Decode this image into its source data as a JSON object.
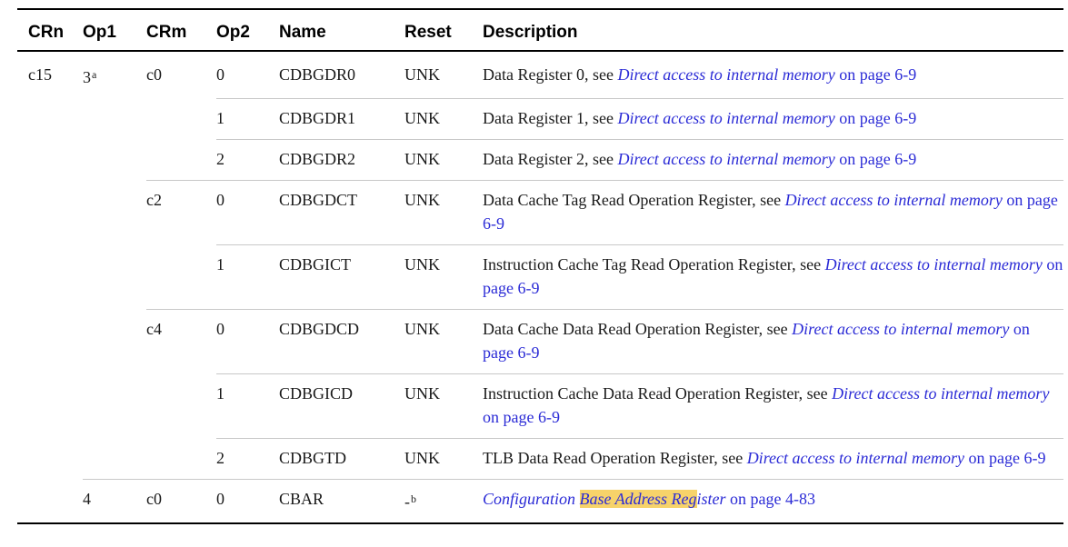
{
  "headers": [
    "CRn",
    "Op1",
    "CRm",
    "Op2",
    "Name",
    "Reset",
    "Description"
  ],
  "link_text": "Direct access to internal memory",
  "page_ref": "on page 6-9",
  "rows": [
    {
      "crn": "c15",
      "op1": "3",
      "op1_note": "a",
      "crm": "c0",
      "op2": "0",
      "name": "CDBGDR0",
      "reset": "UNK",
      "desc_pre": "Data Register 0, see ",
      "desc_link": "Direct access to internal memory",
      "desc_post": " on page 6-9"
    },
    {
      "crn": "",
      "op1": "",
      "op1_note": "",
      "crm": "",
      "op2": "1",
      "name": "CDBGDR1",
      "reset": "UNK",
      "desc_pre": "Data Register 1, see ",
      "desc_link": "Direct access to internal memory",
      "desc_post": " on page 6-9"
    },
    {
      "crn": "",
      "op1": "",
      "op1_note": "",
      "crm": "",
      "op2": "2",
      "name": "CDBGDR2",
      "reset": "UNK",
      "desc_pre": "Data Register 2, see ",
      "desc_link": "Direct access to internal memory",
      "desc_post": " on page 6-9"
    },
    {
      "crn": "",
      "op1": "",
      "op1_note": "",
      "crm": "c2",
      "op2": "0",
      "name": "CDBGDCT",
      "reset": "UNK",
      "desc_pre": "Data Cache Tag Read Operation Register, see ",
      "desc_link": "Direct access to internal memory",
      "desc_post": " on page 6-9"
    },
    {
      "crn": "",
      "op1": "",
      "op1_note": "",
      "crm": "",
      "op2": "1",
      "name": "CDBGICT",
      "reset": "UNK",
      "desc_pre": "Instruction Cache Tag Read Operation Register, see ",
      "desc_link": "Direct access to internal memory",
      "desc_post": " on page 6-9"
    },
    {
      "crn": "",
      "op1": "",
      "op1_note": "",
      "crm": "c4",
      "op2": "0",
      "name": "CDBGDCD",
      "reset": "UNK",
      "desc_pre": "Data Cache Data Read Operation Register, see ",
      "desc_link": "Direct access to internal memory",
      "desc_post": " on page 6-9"
    },
    {
      "crn": "",
      "op1": "",
      "op1_note": "",
      "crm": "",
      "op2": "1",
      "name": "CDBGICD",
      "reset": "UNK",
      "desc_pre": "Instruction Cache Data Read Operation Register, see ",
      "desc_link": "Direct access to internal memory",
      "desc_post": " on page 6-9"
    },
    {
      "crn": "",
      "op1": "",
      "op1_note": "",
      "crm": "",
      "op2": "2",
      "name": "CDBGTD",
      "reset": "UNK",
      "desc_pre": "TLB Data Read Operation Register, see ",
      "desc_link": "Direct access to internal memory",
      "desc_post": " on page 6-9"
    }
  ],
  "last_row": {
    "op1": "4",
    "crm": "c0",
    "op2": "0",
    "name": "CBAR",
    "reset": "-",
    "reset_note": "b",
    "desc_link_a": "Configuration ",
    "desc_link_hl": "Base Address Reg",
    "desc_link_b": "ister",
    "desc_post": " on page 4-83"
  }
}
